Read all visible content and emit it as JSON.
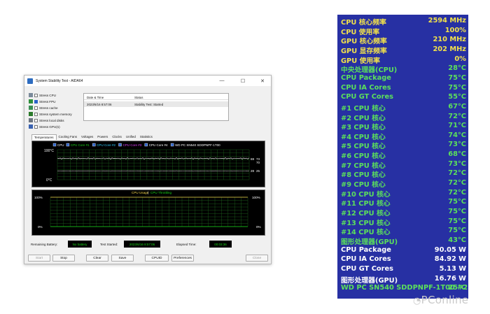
{
  "window": {
    "title": "System Stability Test - AIDA64",
    "controls": {
      "minimize": "—",
      "maximize": "☐",
      "close": "✕"
    }
  },
  "stress": [
    {
      "label": "Stress CPU",
      "checked": false,
      "icon": "cpu-icon"
    },
    {
      "label": "Stress FPU",
      "checked": true,
      "icon": "fpu-icon"
    },
    {
      "label": "Stress cache",
      "checked": false,
      "icon": "cache-icon"
    },
    {
      "label": "Stress system memory",
      "checked": false,
      "icon": "memory-icon"
    },
    {
      "label": "Stress local disks",
      "checked": false,
      "icon": "disk-icon"
    },
    {
      "label": "Stress GPU(s)",
      "checked": false,
      "icon": "gpu-icon"
    }
  ],
  "status_table": {
    "col_datetime": "Date & Time",
    "col_status": "Status",
    "row_datetime": "2023/6/16 8:57:06",
    "row_status": "Stability Test: Started"
  },
  "tabs": [
    "Temperatures",
    "Cooling Fans",
    "Voltages",
    "Powers",
    "Clocks",
    "Unified",
    "Statistics"
  ],
  "temp_graph": {
    "legend": [
      {
        "label": "CPU",
        "color": "#ffffff"
      },
      {
        "label": "CPU Core #1",
        "color": "#17d617"
      },
      {
        "label": "CPU Core #2",
        "color": "#2fd0ff"
      },
      {
        "label": "CPU Core #3",
        "color": "#e040fb"
      },
      {
        "label": "CPU Core #4",
        "color": "#ffffff"
      },
      {
        "label": "WD PC SN540 SDDPNPF-1T00",
        "color": "#ffffff"
      }
    ],
    "y_top": "100°C",
    "y_bottom": "0°C",
    "right_values": [
      "69",
      "73",
      "70",
      "28",
      "25"
    ]
  },
  "usage_graph": {
    "title_usage": "CPU Usage",
    "separator": "|",
    "title_throttle": "CPU Throttling",
    "usage_color": "#f3d54a",
    "throttle_color": "#17d617",
    "left_top": "100%",
    "left_bottom": "0%",
    "right_top": "100%",
    "right_bottom": "0%"
  },
  "bottom": {
    "battery_label": "Remaining Battery:",
    "battery_value": "No battery",
    "started_label": "Test Started:",
    "started_value": "2023/6/16 8:57:06",
    "elapsed_label": "Elapsed Time:",
    "elapsed_value": "00:03:36"
  },
  "buttons": {
    "start": "Start",
    "stop": "Stop",
    "clear": "Clear",
    "save": "Save",
    "cpuid": "CPUID",
    "preferences": "Preferences",
    "close": "Close"
  },
  "panel": [
    {
      "k": "CPU 核心频率",
      "v": "2594 MHz",
      "color": "#f3e24a"
    },
    {
      "k": "CPU 使用率",
      "v": "100%",
      "color": "#f3e24a"
    },
    {
      "k": "GPU 核心频率",
      "v": "210 MHz",
      "color": "#f3e24a"
    },
    {
      "k": "GPU 显存频率",
      "v": "202 MHz",
      "color": "#f3e24a"
    },
    {
      "k": "GPU 使用率",
      "v": "0%",
      "color": "#f3e24a"
    },
    {
      "k": "中央处理器(CPU)",
      "v": "28°C",
      "color": "#5be05b"
    },
    {
      "k": "CPU Package",
      "v": "75°C",
      "color": "#5be05b"
    },
    {
      "k": "CPU IA Cores",
      "v": "75°C",
      "color": "#5be05b"
    },
    {
      "k": "CPU GT Cores",
      "v": "55°C",
      "color": "#5be05b"
    },
    {
      "k": "#1 CPU 核心",
      "v": "67°C",
      "color": "#5be05b"
    },
    {
      "k": "#2 CPU 核心",
      "v": "72°C",
      "color": "#5be05b"
    },
    {
      "k": "#3 CPU 核心",
      "v": "71°C",
      "color": "#5be05b"
    },
    {
      "k": "#4 CPU 核心",
      "v": "74°C",
      "color": "#5be05b"
    },
    {
      "k": "#5 CPU 核心",
      "v": "73°C",
      "color": "#5be05b"
    },
    {
      "k": "#6 CPU 核心",
      "v": "68°C",
      "color": "#5be05b"
    },
    {
      "k": "#7 CPU 核心",
      "v": "73°C",
      "color": "#5be05b"
    },
    {
      "k": "#8 CPU 核心",
      "v": "72°C",
      "color": "#5be05b"
    },
    {
      "k": "#9 CPU 核心",
      "v": "72°C",
      "color": "#5be05b"
    },
    {
      "k": "#10 CPU 核心",
      "v": "72°C",
      "color": "#5be05b"
    },
    {
      "k": "#11 CPU 核心",
      "v": "75°C",
      "color": "#5be05b"
    },
    {
      "k": "#12 CPU 核心",
      "v": "75°C",
      "color": "#5be05b"
    },
    {
      "k": "#13 CPU 核心",
      "v": "75°C",
      "color": "#5be05b"
    },
    {
      "k": "#14 CPU 核心",
      "v": "75°C",
      "color": "#5be05b"
    },
    {
      "k": "图形处理器(GPU)",
      "v": "43°C",
      "color": "#5be05b"
    },
    {
      "k": "CPU Package",
      "v": "90.05 W",
      "color": "#ffffff"
    },
    {
      "k": "CPU IA Cores",
      "v": "84.92 W",
      "color": "#ffffff"
    },
    {
      "k": "CPU GT Cores",
      "v": "5.13 W",
      "color": "#ffffff"
    },
    {
      "k": "图形处理器(GPU)",
      "v": "16.76 W",
      "color": "#ffffff"
    },
    {
      "k": "WD PC SN540 SDDPNPF-1T00 #2",
      "v": "25°C",
      "color": "#5be05b"
    }
  ],
  "watermark": "PConline"
}
